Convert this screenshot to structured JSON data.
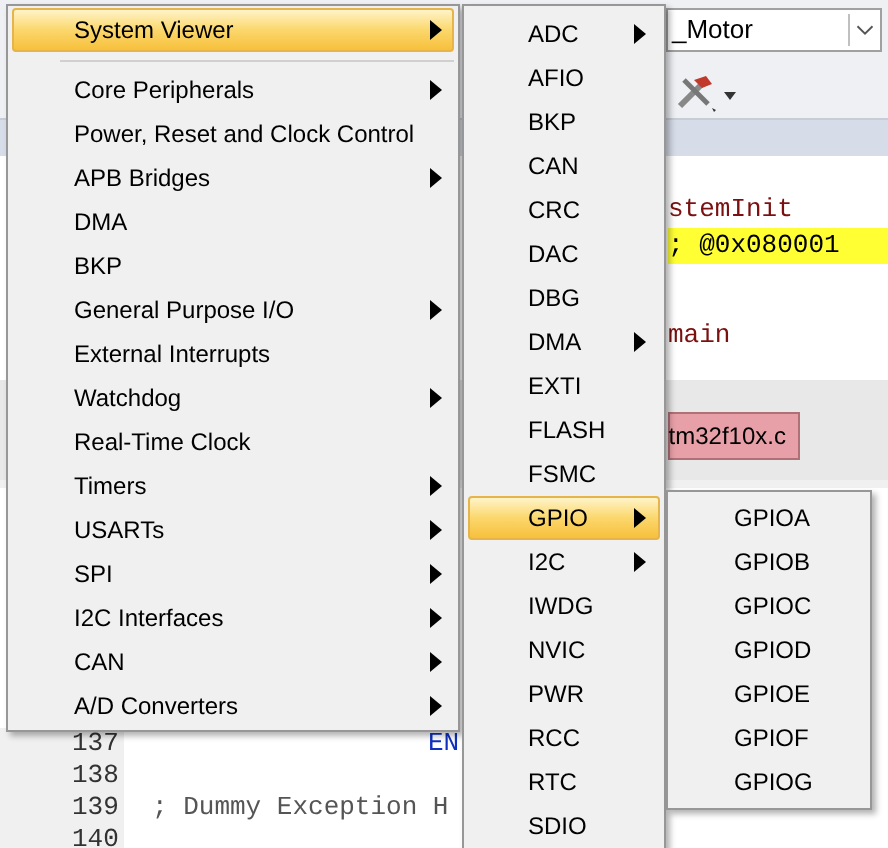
{
  "editor": {
    "project_combo": "_Motor",
    "code_lines": [
      {
        "text": "stemInit",
        "highlighted": false
      },
      {
        "text": "; @0x080001",
        "highlighted": true
      },
      {
        "text": "main",
        "highlighted": false
      }
    ],
    "file_tab": "tm32f10x.c",
    "line_numbers": [
      "137",
      "138",
      "139",
      "140"
    ],
    "line_137": "EN",
    "line_139": "; Dummy Exception H"
  },
  "menu": [
    {
      "label": "System Viewer",
      "has_submenu": true,
      "selected": true
    },
    {
      "label": "Core Peripherals",
      "has_submenu": true,
      "selected": false
    },
    {
      "label": "Power, Reset and Clock Control",
      "has_submenu": false,
      "selected": false
    },
    {
      "label": "APB Bridges",
      "has_submenu": true,
      "selected": false
    },
    {
      "label": "DMA",
      "has_submenu": false,
      "selected": false
    },
    {
      "label": "BKP",
      "has_submenu": false,
      "selected": false
    },
    {
      "label": "General Purpose I/O",
      "has_submenu": true,
      "selected": false
    },
    {
      "label": "External Interrupts",
      "has_submenu": false,
      "selected": false
    },
    {
      "label": "Watchdog",
      "has_submenu": true,
      "selected": false
    },
    {
      "label": "Real-Time Clock",
      "has_submenu": false,
      "selected": false
    },
    {
      "label": "Timers",
      "has_submenu": true,
      "selected": false
    },
    {
      "label": "USARTs",
      "has_submenu": true,
      "selected": false
    },
    {
      "label": "SPI",
      "has_submenu": true,
      "selected": false
    },
    {
      "label": "I2C Interfaces",
      "has_submenu": true,
      "selected": false
    },
    {
      "label": "CAN",
      "has_submenu": true,
      "selected": false
    },
    {
      "label": "A/D Converters",
      "has_submenu": true,
      "selected": false
    }
  ],
  "system_viewer_menu": [
    {
      "label": "ADC",
      "has_submenu": true,
      "selected": false
    },
    {
      "label": "AFIO",
      "has_submenu": false,
      "selected": false
    },
    {
      "label": "BKP",
      "has_submenu": false,
      "selected": false
    },
    {
      "label": "CAN",
      "has_submenu": false,
      "selected": false
    },
    {
      "label": "CRC",
      "has_submenu": false,
      "selected": false
    },
    {
      "label": "DAC",
      "has_submenu": false,
      "selected": false
    },
    {
      "label": "DBG",
      "has_submenu": false,
      "selected": false
    },
    {
      "label": "DMA",
      "has_submenu": true,
      "selected": false
    },
    {
      "label": "EXTI",
      "has_submenu": false,
      "selected": false
    },
    {
      "label": "FLASH",
      "has_submenu": false,
      "selected": false
    },
    {
      "label": "FSMC",
      "has_submenu": false,
      "selected": false
    },
    {
      "label": "GPIO",
      "has_submenu": true,
      "selected": true
    },
    {
      "label": "I2C",
      "has_submenu": true,
      "selected": false
    },
    {
      "label": "IWDG",
      "has_submenu": false,
      "selected": false
    },
    {
      "label": "NVIC",
      "has_submenu": false,
      "selected": false
    },
    {
      "label": "PWR",
      "has_submenu": false,
      "selected": false
    },
    {
      "label": "RCC",
      "has_submenu": false,
      "selected": false
    },
    {
      "label": "RTC",
      "has_submenu": false,
      "selected": false
    },
    {
      "label": "SDIO",
      "has_submenu": false,
      "selected": false
    }
  ],
  "gpio_menu": [
    {
      "label": "GPIOA",
      "selected": false
    },
    {
      "label": "GPIOB",
      "selected": false
    },
    {
      "label": "GPIOC",
      "selected": false
    },
    {
      "label": "GPIOD",
      "selected": false
    },
    {
      "label": "GPIOE",
      "selected": false
    },
    {
      "label": "GPIOF",
      "selected": false
    },
    {
      "label": "GPIOG",
      "selected": false
    }
  ]
}
